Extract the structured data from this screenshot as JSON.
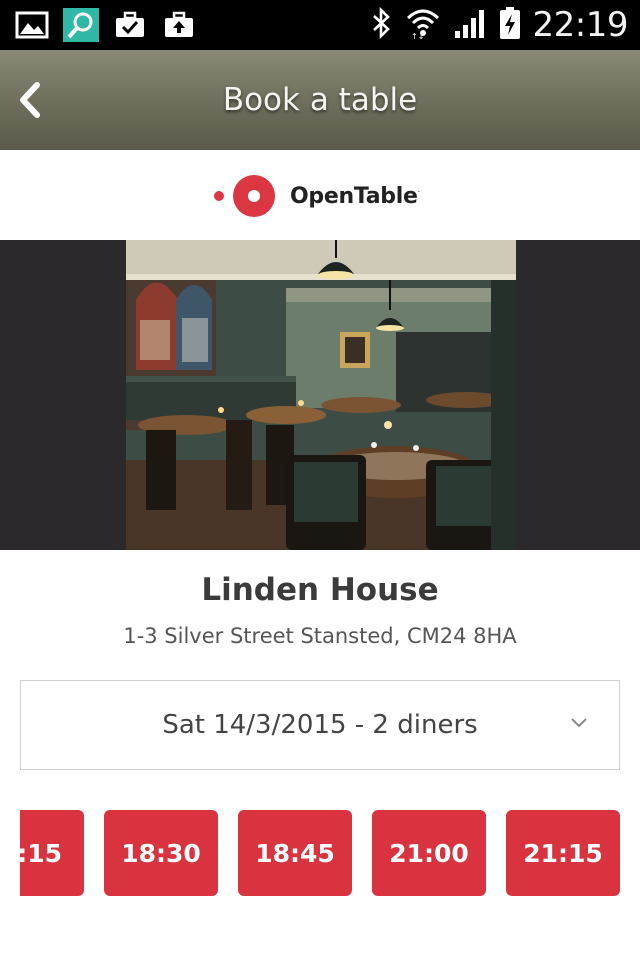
{
  "status_bar": {
    "left_icons": [
      "gallery-icon",
      "search-icon",
      "briefcase-check-icon",
      "briefcase-upload-icon"
    ],
    "right_icons": [
      "bluetooth-icon",
      "wifi-icon",
      "signal-icon",
      "battery-charging-icon"
    ],
    "time": "22:19"
  },
  "app_bar": {
    "title": "Book a table",
    "back_icon": "chevron-left-icon"
  },
  "logo": {
    "text": "OpenTable",
    "tm": "·",
    "brand_color": "#da3743"
  },
  "restaurant": {
    "name": "Linden House",
    "address": "1-3 Silver Street Stansted, CM24 8HA"
  },
  "booking": {
    "date_selection": "Sat 14/3/2015 - 2 diners",
    "chevron_icon": "chevron-down-icon"
  },
  "time_slots": [
    ":15",
    "18:30",
    "18:45",
    "21:00",
    "21:15"
  ],
  "colors": {
    "accent": "#d93340",
    "appbar": "#6e6c5b",
    "status_bar": "#000000"
  }
}
